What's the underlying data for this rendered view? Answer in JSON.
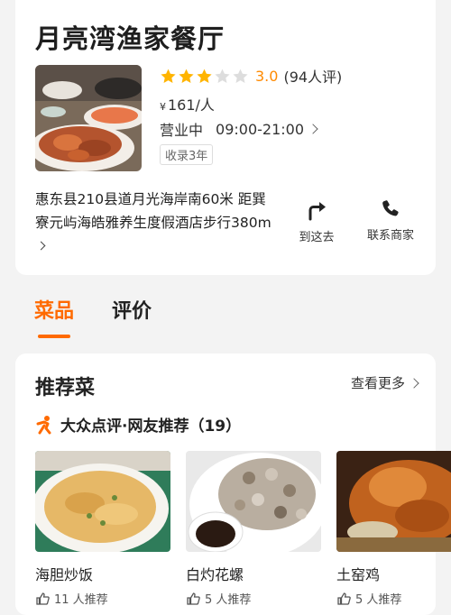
{
  "restaurant": {
    "name": "月亮湾渔家餐厅",
    "rating": 3.0,
    "rating_display": "3.0",
    "stars_filled": 3,
    "stars_total": 5,
    "review_count": "(94人评)",
    "price_symbol": "¥",
    "price": "161/人",
    "status": "营业中",
    "hours": "09:00-21:00",
    "tag": "收录3年",
    "address": "惠东县210县道月光海岸南60米 距巽寮元屿海皓雅养生度假酒店步行380m"
  },
  "actions": {
    "navigate_label": "到这去",
    "call_label": "联系商家"
  },
  "tabs": [
    {
      "label": "菜品",
      "active": true
    },
    {
      "label": "评价",
      "active": false
    }
  ],
  "recommended": {
    "title": "推荐菜",
    "more_label": "查看更多",
    "source_label": "大众点评·网友推荐（19）",
    "dishes": [
      {
        "name": "海胆炒饭",
        "likes": "11 人推荐"
      },
      {
        "name": "白灼花螺",
        "likes": "5 人推荐"
      },
      {
        "name": "土窑鸡",
        "likes": "5 人推荐"
      }
    ]
  },
  "colors": {
    "accent": "#ff6a00",
    "star": "#ffb400",
    "score": "#ff8a00"
  }
}
